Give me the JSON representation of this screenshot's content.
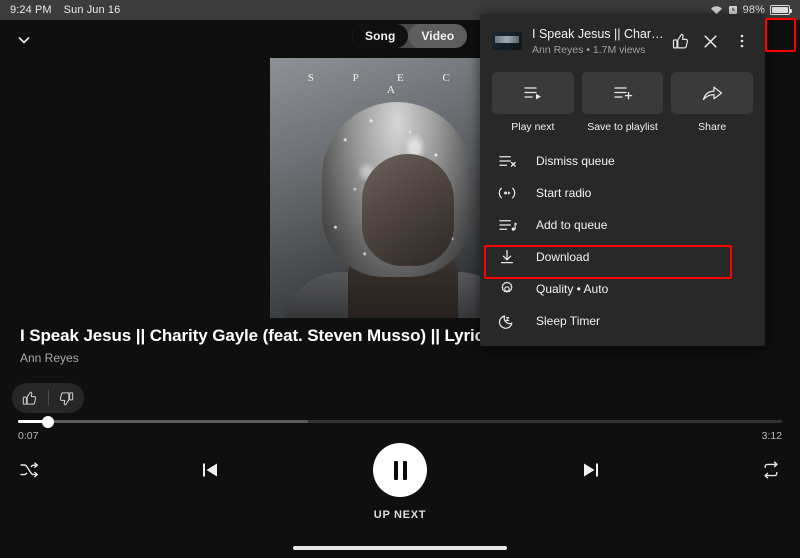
{
  "status_bar": {
    "time": "9:24 PM",
    "date": "Sun Jun 16",
    "wifi_icon": "wifi-icon",
    "alarm_icon": "alarm-icon",
    "battery_percent": "98%",
    "battery_icon": "battery-icon"
  },
  "player": {
    "collapse_icon": "chevron-down-icon",
    "mode_toggle": {
      "song_label": "Song",
      "video_label": "Video",
      "selected": "Song"
    },
    "album_art": {
      "name": "album-artwork",
      "overlay_text": "S P E C I A"
    },
    "track": {
      "title": "I Speak Jesus || Charity Gayle (feat. Steven Musso) || Lyric Vide",
      "artist": "Ann Reyes"
    },
    "rating": {
      "like_icon": "thumbs-up-icon",
      "dislike_icon": "thumbs-down-icon"
    },
    "progress": {
      "current_time": "0:07",
      "total_time": "3:12",
      "played_percent": 3.9,
      "buffered_percent": 38
    },
    "controls": {
      "shuffle_icon": "shuffle-icon",
      "previous_icon": "previous-track-icon",
      "play_pause_icon": "pause-icon",
      "next_icon": "next-track-icon",
      "repeat_icon": "repeat-icon"
    },
    "up_next_label": "UP NEXT"
  },
  "menu": {
    "header": {
      "title": "I Speak Jesus || Charity G...",
      "subtitle": "Ann Reyes • 1.7M views",
      "like_icon": "thumbs-up-icon",
      "close_icon": "close-icon",
      "more_icon": "more-vertical-icon",
      "thumbnail": "video-thumbnail"
    },
    "quick_actions": [
      {
        "label": "Play next",
        "icon": "play-next-icon"
      },
      {
        "label": "Save to playlist",
        "icon": "save-to-playlist-icon"
      },
      {
        "label": "Share",
        "icon": "share-icon"
      }
    ],
    "items": [
      {
        "label": "Dismiss queue",
        "icon": "dismiss-queue-icon"
      },
      {
        "label": "Start radio",
        "icon": "radio-icon"
      },
      {
        "label": "Add to queue",
        "icon": "add-to-queue-icon"
      },
      {
        "label": "Download",
        "icon": "download-icon"
      },
      {
        "label": "Quality • Auto",
        "icon": "gear-icon"
      },
      {
        "label": "Sleep Timer",
        "icon": "sleep-timer-icon"
      }
    ]
  },
  "annotations": {
    "highlight_color": "#ff0000",
    "boxes": [
      {
        "name": "more-options-highlight",
        "target": "more-vertical-icon"
      },
      {
        "name": "download-highlight",
        "target": "Download"
      }
    ]
  },
  "colors": {
    "background": "#0f0f0f",
    "status_bar": "#3c3c3c",
    "menu_background": "#282828",
    "accent_white": "#ffffff",
    "highlight_red": "#ff0000"
  }
}
